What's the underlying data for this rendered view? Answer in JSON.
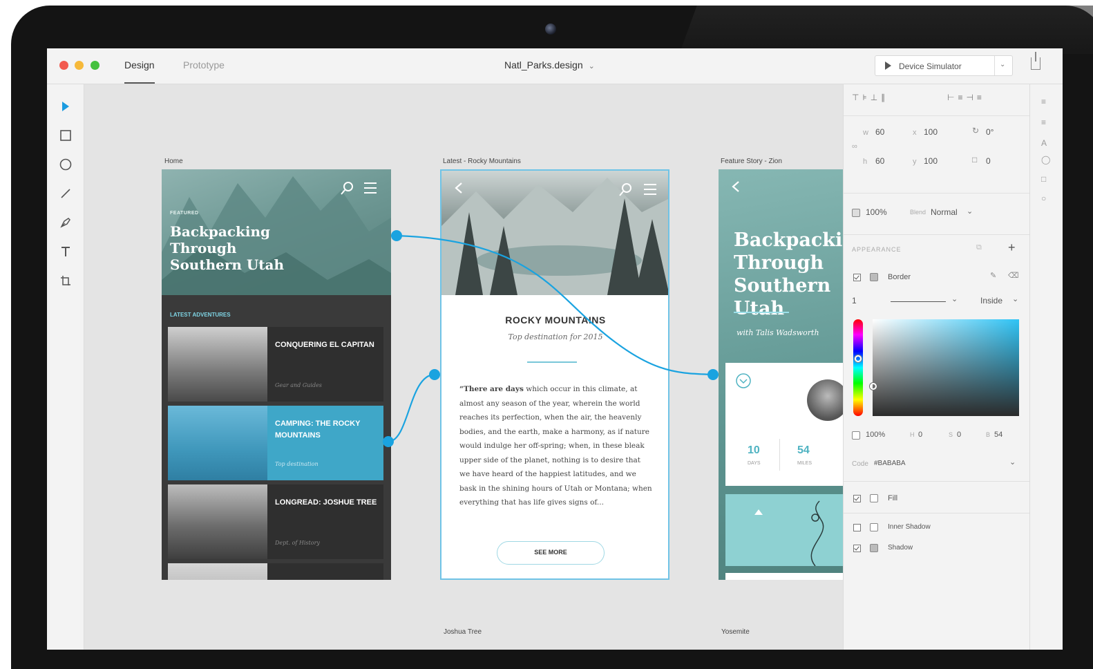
{
  "window": {
    "tabs": [
      {
        "label": "Design",
        "active": true
      },
      {
        "label": "Prototype",
        "active": false
      }
    ],
    "filename": "Natl_Parks.design",
    "device_simulator": "Device Simulator"
  },
  "toolbar": {
    "tools": [
      "select-icon",
      "rectangle-icon",
      "ellipse-icon",
      "line-icon",
      "pen-icon",
      "text-icon",
      "artboard-icon"
    ]
  },
  "artboards": {
    "home": {
      "label": "Home",
      "featured": "FEATURED",
      "title": "Backpacking Through Southern Utah",
      "latest": "LATEST ADVENTURES",
      "cards": [
        {
          "title": "CONQUERING EL CAPITAN",
          "subtitle": "Gear and Guides"
        },
        {
          "title": "CAMPING: THE ROCKY MOUNTAINS",
          "subtitle": "Top destination"
        },
        {
          "title": "LONGREAD: JOSHUE TREE",
          "subtitle": "Dept. of History"
        }
      ]
    },
    "rocky": {
      "label": "Latest - Rocky Mountains",
      "title": "ROCKY MOUNTAINS",
      "subtitle": "Top destination for 2015",
      "body_bold": "“There are days",
      "body": " which occur in this climate, at almost any season of the year, wherein the world reaches its perfection, when the air, the heavenly bodies, and the earth, make a harmony, as if nature would indulge her off-spring; when, in these bleak upper side of the planet, nothing is to desire that we have heard of the happiest latitudes, and we bask in the shining hours of Utah or Montana; when everything that has life gives signs of...",
      "see_more": "SEE MORE"
    },
    "feature": {
      "label": "Feature Story - Zion",
      "title": "Backpacking Through Southern Utah",
      "byline": "with Talis Wadsworth",
      "stats": [
        {
          "num": "10",
          "unit": "DAYS"
        },
        {
          "num": "54",
          "unit": "MILES"
        }
      ]
    },
    "bottom_labels": [
      "Joshua Tree",
      "Yosemite"
    ]
  },
  "panel": {
    "w": "60",
    "x": "100",
    "rotate": "0°",
    "h": "60",
    "y": "100",
    "radius": "0",
    "opacity": "100%",
    "blend_label": "Blend",
    "blend": "Normal",
    "appearance": "APPEARANCE",
    "border_label": "Border",
    "border_width": "1",
    "border_pos": "Inside",
    "color_opacity": "100%",
    "color_x": "0",
    "color_s": "0",
    "color_b": "54",
    "code_label": "Code",
    "code": "#BABABA",
    "fill_label": "Fill",
    "inner_shadow_label": "Inner Shadow",
    "shadow_label": "Shadow"
  },
  "colors": {
    "accent": "#1aa3e0",
    "selected_card": "#3fa7c8",
    "canvas": "#e4e4e4"
  }
}
